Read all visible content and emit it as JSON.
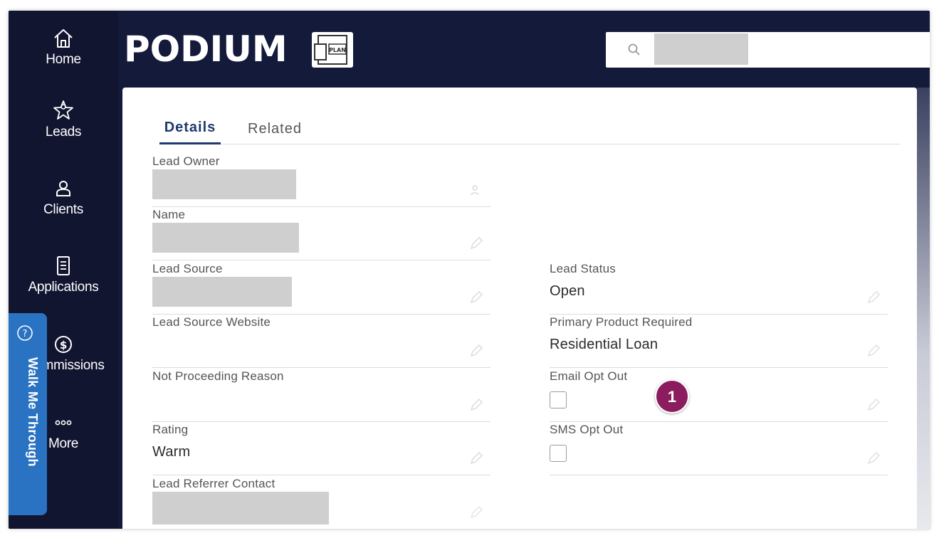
{
  "nav": {
    "items": [
      {
        "label": "Home",
        "icon": "home-icon"
      },
      {
        "label": "Leads",
        "icon": "star-person-icon"
      },
      {
        "label": "Clients",
        "icon": "person-icon"
      },
      {
        "label": "Applications",
        "icon": "document-icon"
      },
      {
        "label": "mmissions",
        "icon": "dollar-circle-icon"
      },
      {
        "label": "More",
        "icon": "more-dots-icon"
      }
    ]
  },
  "header": {
    "logo_text": "PODIUM",
    "badge_text": "PLAN"
  },
  "tabs": [
    {
      "label": "Details",
      "active": true
    },
    {
      "label": "Related",
      "active": false
    }
  ],
  "fields": {
    "lead_owner": {
      "label": "Lead Owner"
    },
    "name": {
      "label": "Name"
    },
    "lead_source": {
      "label": "Lead Source"
    },
    "lead_status": {
      "label": "Lead Status",
      "value": "Open"
    },
    "lead_source_website": {
      "label": "Lead Source Website",
      "value": ""
    },
    "primary_product": {
      "label": "Primary Product Required",
      "value": "Residential Loan"
    },
    "not_proceeding_reason": {
      "label": "Not Proceeding Reason",
      "value": ""
    },
    "email_opt_out": {
      "label": "Email Opt Out",
      "checked": false
    },
    "rating": {
      "label": "Rating",
      "value": "Warm"
    },
    "sms_opt_out": {
      "label": "SMS Opt Out",
      "checked": false
    },
    "lead_referrer_contact": {
      "label": "Lead Referrer Contact"
    }
  },
  "step_badge": "1",
  "walkme": {
    "label": "Walk Me Through"
  },
  "colors": {
    "nav_bg": "#111530",
    "header_bg": "#141a3a",
    "tab_active": "#1e3a6e",
    "step_badge": "#8b1d5e",
    "walkme": "#2a72c2"
  }
}
